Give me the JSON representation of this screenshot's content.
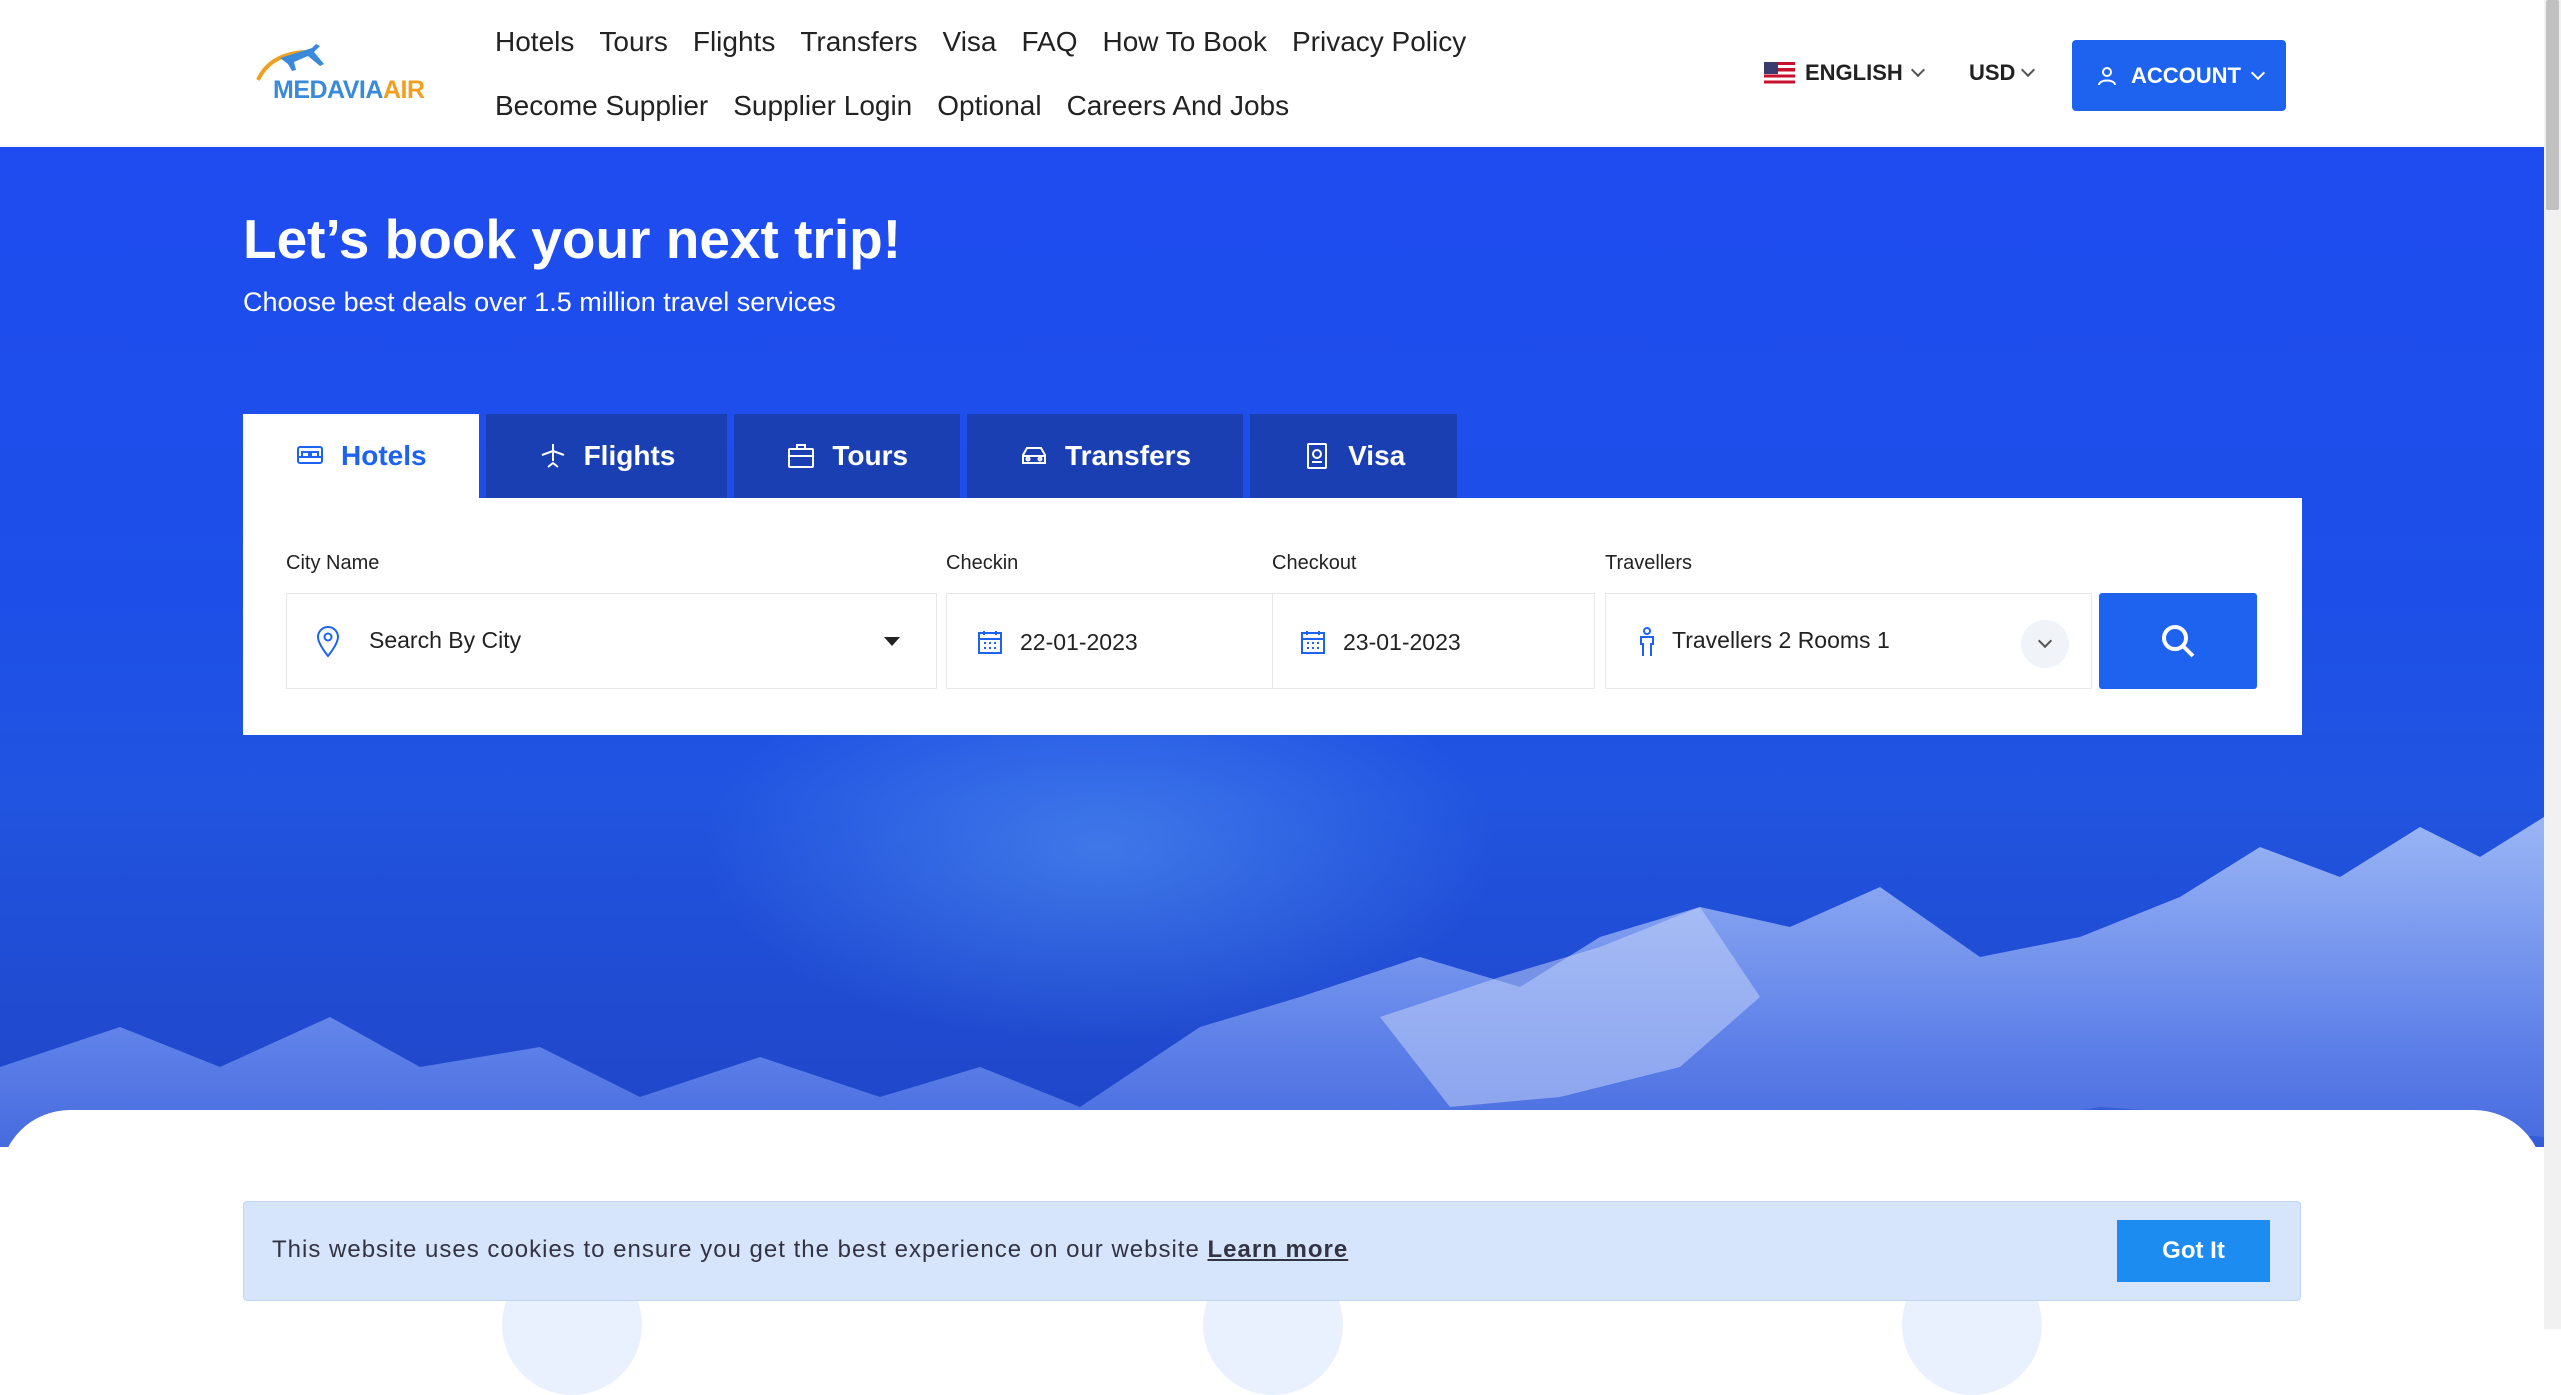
{
  "header": {
    "logo": {
      "part1": "MEDAVIA",
      "part2": "AIR"
    },
    "nav_row1": [
      "Hotels",
      "Tours",
      "Flights",
      "Transfers",
      "Visa",
      "FAQ",
      "How To Book",
      "Privacy Policy"
    ],
    "nav_row2": [
      "Become Supplier",
      "Supplier Login",
      "Optional",
      "Careers And Jobs"
    ],
    "language": "ENGLISH",
    "currency": "USD",
    "account_label": "ACCOUNT"
  },
  "hero": {
    "title": "Let’s book your next trip!",
    "subtitle": "Choose best deals over 1.5 million travel services"
  },
  "tabs": [
    {
      "label": "Hotels",
      "icon": "bed-icon",
      "active": true
    },
    {
      "label": "Flights",
      "icon": "plane-icon",
      "active": false
    },
    {
      "label": "Tours",
      "icon": "briefcase-icon",
      "active": false
    },
    {
      "label": "Transfers",
      "icon": "car-icon",
      "active": false
    },
    {
      "label": "Visa",
      "icon": "passport-icon",
      "active": false
    }
  ],
  "search": {
    "city_label": "City Name",
    "city_placeholder": "Search By City",
    "checkin_label": "Checkin",
    "checkin_value": "22-01-2023",
    "checkout_label": "Checkout",
    "checkout_value": "23-01-2023",
    "travellers_label": "Travellers",
    "travellers_text": "Travellers",
    "travellers_count": "2",
    "rooms_text": "Rooms",
    "rooms_count": "1"
  },
  "cookie": {
    "message": "This website uses cookies to ensure you get the best experience on our website",
    "link": "Learn more",
    "button": "Got It"
  },
  "colors": {
    "primary": "#1d63f0",
    "hero_bg": "#1f4cf0",
    "tab_inactive": "#1a3fb3",
    "cookie_bg": "#d6e5fb"
  }
}
